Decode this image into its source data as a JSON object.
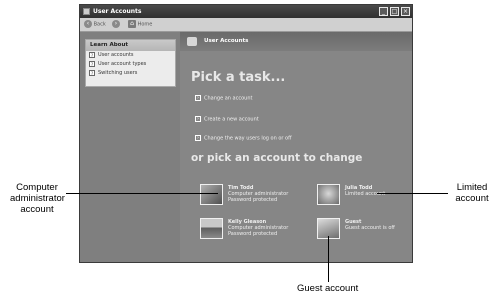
{
  "window": {
    "title": "User Accounts"
  },
  "toolbar": {
    "back_label": "Back",
    "home_label": "Home"
  },
  "sidebar": {
    "learn_about": {
      "header": "Learn About",
      "items": [
        {
          "label": "User accounts"
        },
        {
          "label": "User account types"
        },
        {
          "label": "Switching users"
        }
      ]
    }
  },
  "main": {
    "header_title": "User Accounts",
    "pick_task": "Pick a task...",
    "tasks": [
      {
        "label": "Change an account"
      },
      {
        "label": "Create a new account"
      },
      {
        "label": "Change the way users log on or off"
      }
    ],
    "pick_account": "or pick an account to change",
    "accounts": [
      {
        "name": "Tim Todd",
        "line1": "Computer administrator",
        "line2": "Password protected"
      },
      {
        "name": "Julia Todd",
        "line1": "Limited account",
        "line2": ""
      },
      {
        "name": "Kelly Gleason",
        "line1": "Computer administrator",
        "line2": "Password protected"
      },
      {
        "name": "Guest",
        "line1": "Guest account is off",
        "line2": ""
      }
    ]
  },
  "callouts": {
    "admin_line1": "Computer",
    "admin_line2": "administrator",
    "admin_line3": "account",
    "limited_line1": "Limited",
    "limited_line2": "account",
    "guest": "Guest account"
  }
}
